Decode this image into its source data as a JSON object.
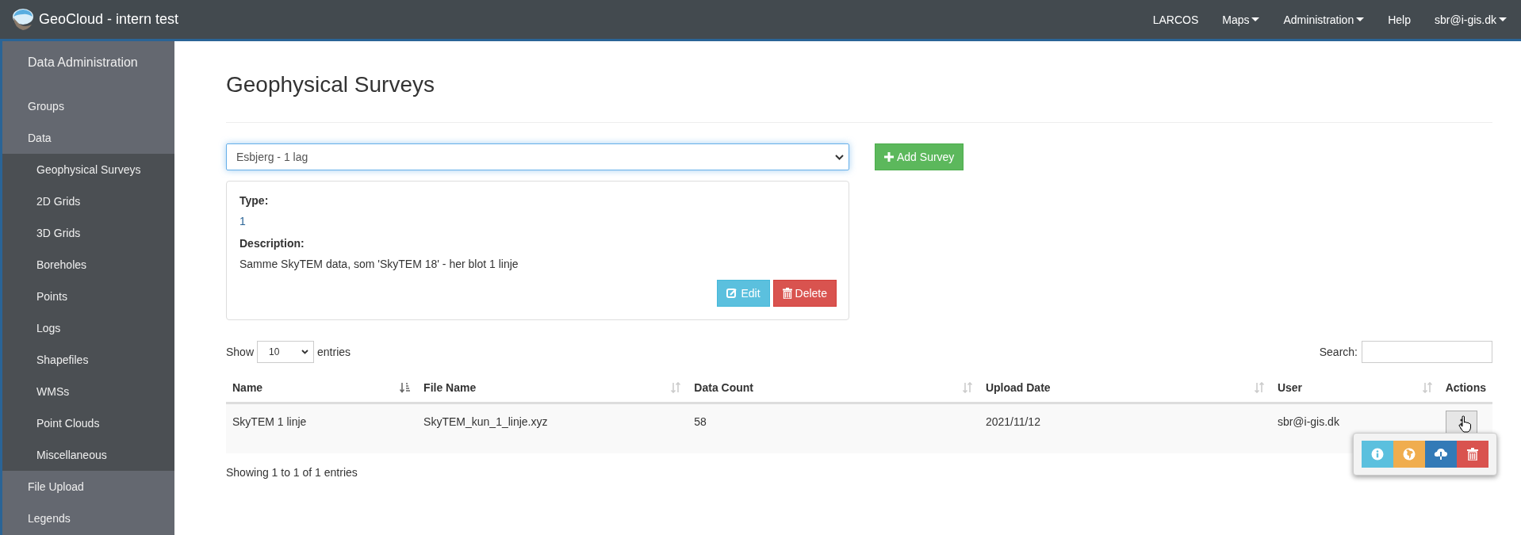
{
  "navbar": {
    "brand": "GeoCloud - intern test",
    "menu": [
      {
        "label": "LARCOS",
        "dropdown": false
      },
      {
        "label": "Maps",
        "dropdown": true
      },
      {
        "label": "Administration",
        "dropdown": true
      },
      {
        "label": "Help",
        "dropdown": false
      },
      {
        "label": "sbr@i-gis.dk",
        "dropdown": true
      }
    ]
  },
  "sidebar": {
    "title": "Data Administration",
    "items": [
      {
        "label": "Groups"
      },
      {
        "label": "Data",
        "expanded": true,
        "children": [
          {
            "label": "Geophysical Surveys"
          },
          {
            "label": "2D Grids"
          },
          {
            "label": "3D Grids"
          },
          {
            "label": "Boreholes"
          },
          {
            "label": "Points"
          },
          {
            "label": "Logs"
          },
          {
            "label": "Shapefiles"
          },
          {
            "label": "WMSs"
          },
          {
            "label": "Point Clouds"
          },
          {
            "label": "Miscellaneous"
          }
        ]
      },
      {
        "label": "File Upload"
      },
      {
        "label": "Legends"
      }
    ]
  },
  "page": {
    "title": "Geophysical Surveys",
    "survey_select": {
      "value": "Esbjerg - 1 lag"
    },
    "add_button": "Add Survey",
    "details": {
      "type_label": "Type:",
      "type_value": "1",
      "description_label": "Description:",
      "description": "Samme SkyTEM data, som 'SkyTEM 18' - her blot 1 linje",
      "edit_button": "Edit",
      "delete_button": "Delete"
    },
    "table": {
      "length": {
        "show": "Show",
        "value": "10",
        "entries": "entries"
      },
      "search_label": "Search:",
      "columns": [
        {
          "label": "Name",
          "sortable": true,
          "sorted": true
        },
        {
          "label": "File Name",
          "sortable": true,
          "sorted": false
        },
        {
          "label": "Data Count",
          "sortable": true,
          "sorted": false
        },
        {
          "label": "Upload Date",
          "sortable": true,
          "sorted": false
        },
        {
          "label": "User",
          "sortable": true,
          "sorted": false
        },
        {
          "label": "Actions",
          "sortable": false
        }
      ],
      "rows": [
        {
          "cells": [
            "SkyTEM 1 linje",
            "SkyTEM_kun_1_linje.xyz",
            "58",
            "2021/11/12",
            "sbr@i-gis.dk"
          ]
        }
      ],
      "info": "Showing 1 to 1 of 1 entries",
      "action_menu": [
        {
          "kind": "info",
          "color": "#5bc0de"
        },
        {
          "kind": "globe",
          "color": "#f0ad4e"
        },
        {
          "kind": "download",
          "color": "#337ab7"
        },
        {
          "kind": "trash",
          "color": "#d9534f"
        }
      ]
    }
  }
}
